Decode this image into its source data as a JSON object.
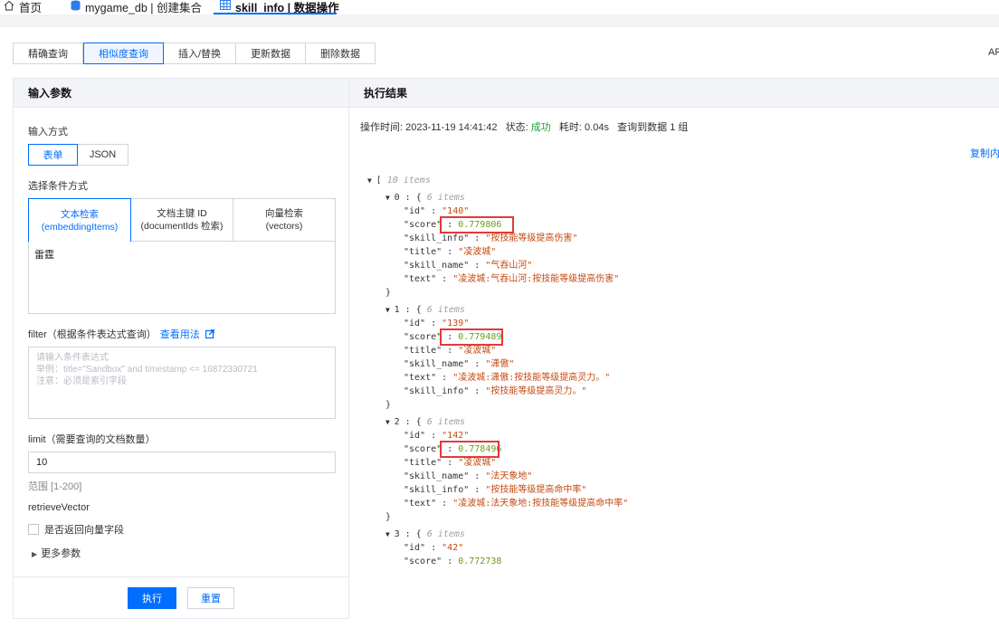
{
  "top_tabs": [
    {
      "label": "首页",
      "icon": "home-icon"
    },
    {
      "label": "mygame_db | 创建集合",
      "icon": "database-icon"
    },
    {
      "label": "skill_info | 数据操作",
      "icon": "table-icon"
    }
  ],
  "query_tabs": [
    "精确查询",
    "相似度查询",
    "插入/替换",
    "更新数据",
    "删除数据"
  ],
  "api_cut": "AP",
  "left": {
    "title": "输入参数",
    "input_mode_label": "输入方式",
    "input_modes": [
      "表单",
      "JSON"
    ],
    "condition_label": "选择条件方式",
    "condition_options": [
      {
        "line1": "文本检索",
        "line2": "(embeddingItems)"
      },
      {
        "line1": "文档主键 ID",
        "line2": "(documentIds 检索)"
      },
      {
        "line1": "向量检索",
        "line2": "(vectors)"
      }
    ],
    "text_value": "雷霆",
    "filter_label": "filter（根据条件表达式查询）",
    "filter_link": "查看用法",
    "filter_placeholder": [
      "请输入条件表达式",
      "举例：title=\"Sandbox\" and timestamp <= 16872330721",
      "注意：必须是索引字段"
    ],
    "limit_label": "limit（需要查询的文档数量）",
    "limit_value": "10",
    "limit_hint": "范围 [1-200]",
    "retrieve_label": "retrieveVector",
    "retrieve_checkbox": "是否返回向量字段",
    "more_params": "更多参数",
    "run_button": "执行",
    "reset_button": "重置"
  },
  "right": {
    "title": "执行结果",
    "meta": {
      "time_label": "操作时间:",
      "time_value": "2023-11-19 14:41:42",
      "status_label": "状态:",
      "status_value": "成功",
      "cost_label": "耗时:",
      "cost_value": "0.04s",
      "count_text": "查询到数据 1 组"
    },
    "copy_link": "复制内",
    "root_count": "10 items",
    "item_count": "6 items",
    "results": [
      {
        "index": "0",
        "fields": [
          [
            "\"id\"",
            "\"140\"",
            "s"
          ],
          [
            "\"score\"",
            "0.779806",
            "n"
          ],
          [
            "\"skill_info\"",
            "\"按技能等级提高伤害\"",
            "s"
          ],
          [
            "\"title\"",
            "\"凌波城\"",
            "s"
          ],
          [
            "\"skill_name\"",
            "\"气吞山河\"",
            "s"
          ],
          [
            "\"text\"",
            "\"凌波城:气吞山河:按技能等级提高伤害\"",
            "s"
          ]
        ]
      },
      {
        "index": "1",
        "fields": [
          [
            "\"id\"",
            "\"139\"",
            "s"
          ],
          [
            "\"score\"",
            "0.779489",
            "n"
          ],
          [
            "\"title\"",
            "\"凌波城\"",
            "s"
          ],
          [
            "\"skill_name\"",
            "\"潇傲\"",
            "s"
          ],
          [
            "\"text\"",
            "\"凌波城:潇傲:按技能等级提高灵力。\"",
            "s"
          ],
          [
            "\"skill_info\"",
            "\"按技能等级提高灵力。\"",
            "s"
          ]
        ]
      },
      {
        "index": "2",
        "fields": [
          [
            "\"id\"",
            "\"142\"",
            "s"
          ],
          [
            "\"score\"",
            "0.778496",
            "n"
          ],
          [
            "\"title\"",
            "\"凌波城\"",
            "s"
          ],
          [
            "\"skill_name\"",
            "\"法天象地\"",
            "s"
          ],
          [
            "\"skill_info\"",
            "\"按技能等级提高命中率\"",
            "s"
          ],
          [
            "\"text\"",
            "\"凌波城:法天象地:按技能等级提高命中率\"",
            "s"
          ]
        ]
      },
      {
        "index": "3",
        "fields": [
          [
            "\"id\"",
            "\"42\"",
            "s"
          ],
          [
            "\"score\"",
            "0.772738",
            "n"
          ]
        ]
      }
    ]
  }
}
